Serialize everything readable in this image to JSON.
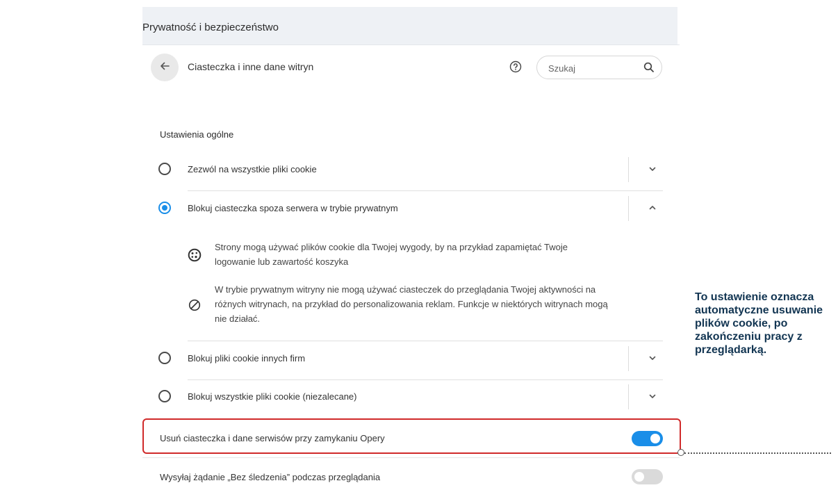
{
  "section_title": "Prywatność i bezpieczeństwo",
  "header": {
    "back_icon": "arrow-left-icon",
    "subtitle": "Ciasteczka i inne dane witryn",
    "help_icon": "question-circle-icon",
    "search_placeholder": "Szukaj",
    "search_icon": "magnifier-icon"
  },
  "general": {
    "heading": "Ustawienia ogólne",
    "options": [
      {
        "label": "Zezwól na wszystkie pliki cookie",
        "selected": false,
        "expanded": false
      },
      {
        "label": "Blokuj ciasteczka spoza serwera w trybie prywatnym",
        "selected": true,
        "expanded": true
      },
      {
        "label": "Blokuj pliki cookie innych firm",
        "selected": false,
        "expanded": false
      },
      {
        "label": "Blokuj wszystkie pliki cookie (niezalecane)",
        "selected": false,
        "expanded": false
      }
    ],
    "details": [
      {
        "icon": "cookie-icon",
        "lines": [
          "Strony mogą używać plików cookie dla Twojej wygody, by na przykład zapamiętać Twoje",
          "logowanie lub zawartość koszyka"
        ]
      },
      {
        "icon": "block-icon",
        "lines": [
          "W trybie prywatnym witryny nie mogą używać ciasteczek do przeglądania Twojej aktywności na",
          "różnych witrynach, na przykład do personalizowania reklam. Funkcje w niektórych witrynach mogą",
          "nie działać."
        ]
      }
    ]
  },
  "toggles": [
    {
      "label": "Usuń ciasteczka i dane serwisów przy zamykaniu Opery",
      "on": true
    },
    {
      "label": "Wysyłaj żądanie „Bez śledzenia” podczas przeglądania",
      "on": false
    }
  ],
  "annotation": {
    "text": "To ustawienie oznacza automatyczne usuwanie plików cookie, po zakończeniu pracy z przeglądarką.",
    "highlight_color": "#d02a2a",
    "text_color": "#123552"
  },
  "colors": {
    "accent": "#1a8ee8",
    "panel_bg": "#eef1f5"
  }
}
